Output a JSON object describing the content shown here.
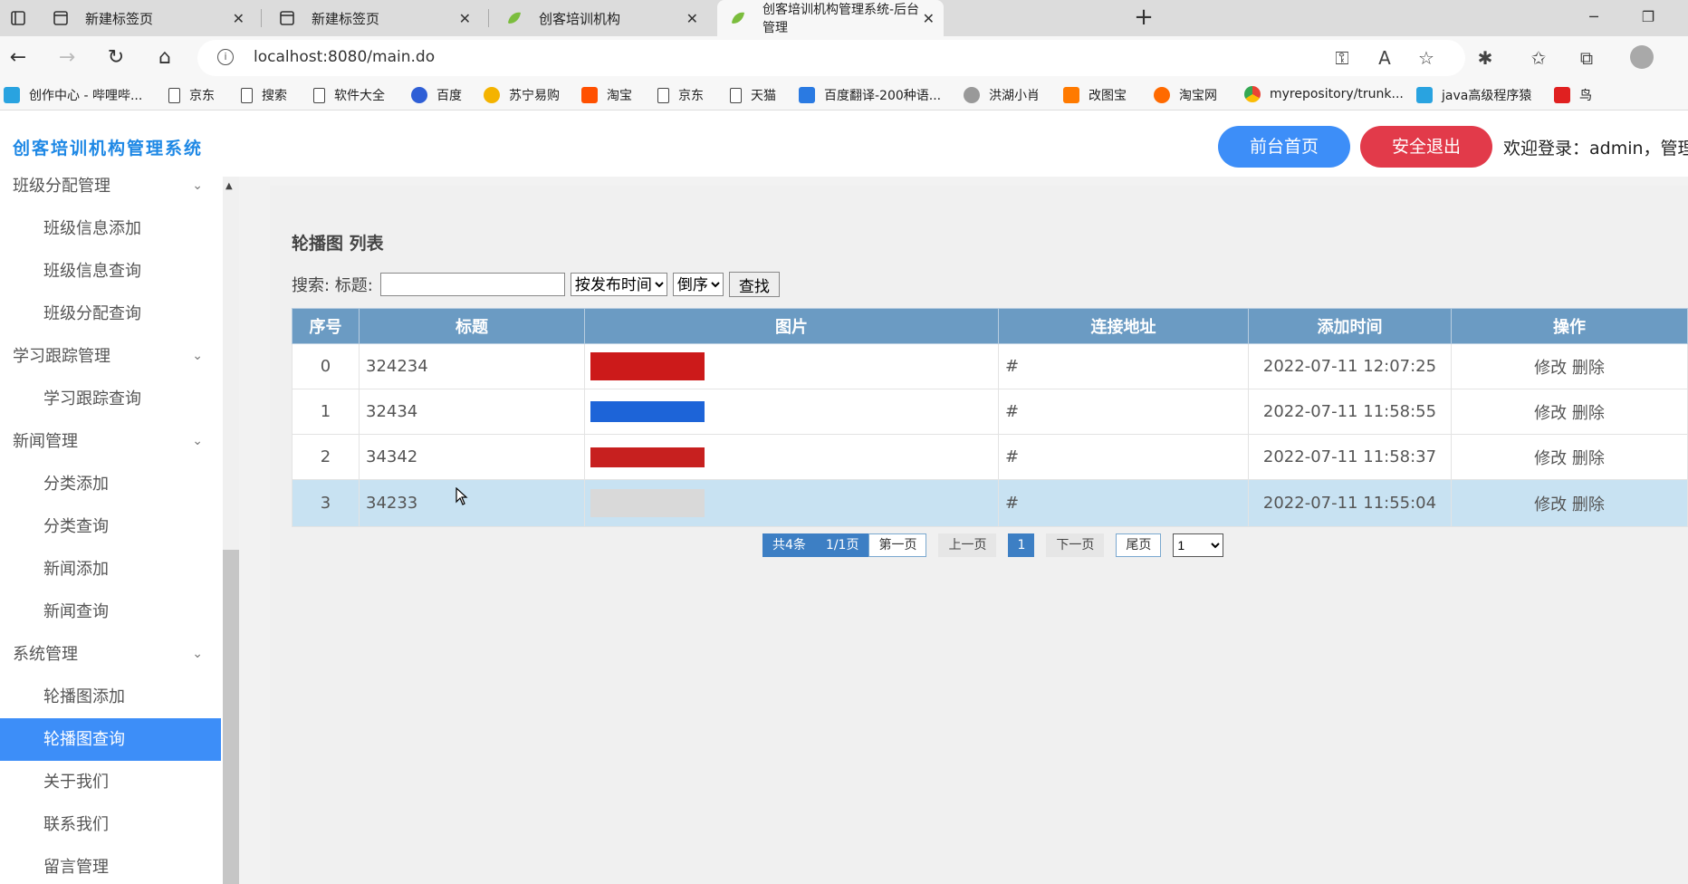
{
  "browser": {
    "tabs": [
      {
        "title": "新建标签页",
        "active": false
      },
      {
        "title": "新建标签页",
        "active": false
      },
      {
        "title": "创客培训机构",
        "active": false
      },
      {
        "title": "创客培训机构管理系统-后台管理",
        "active": true
      }
    ],
    "url": "localhost:8080/main.do",
    "bookmarks": [
      "创作中心 - 哔哩哔...",
      "京东",
      "搜索",
      "软件大全",
      "百度",
      "苏宁易购",
      "淘宝",
      "京东",
      "天猫",
      "百度翻译-200种语...",
      "洪湖小肖",
      "改图宝",
      "淘宝网",
      "myrepository/trunk...",
      "java高级程序猿",
      "鸟"
    ]
  },
  "header": {
    "title": "创客培训机构管理系统",
    "home_button": "前台首页",
    "logout_button": "安全退出",
    "welcome": "欢迎登录：admin，管理员"
  },
  "sidebar": {
    "items": [
      {
        "label": "班级分配管理",
        "type": "group"
      },
      {
        "label": "班级信息添加",
        "type": "child"
      },
      {
        "label": "班级信息查询",
        "type": "child"
      },
      {
        "label": "班级分配查询",
        "type": "child"
      },
      {
        "label": "学习跟踪管理",
        "type": "group"
      },
      {
        "label": "学习跟踪查询",
        "type": "child"
      },
      {
        "label": "新闻管理",
        "type": "group"
      },
      {
        "label": "分类添加",
        "type": "child"
      },
      {
        "label": "分类查询",
        "type": "child"
      },
      {
        "label": "新闻添加",
        "type": "child"
      },
      {
        "label": "新闻查询",
        "type": "child"
      },
      {
        "label": "系统管理",
        "type": "group"
      },
      {
        "label": "轮播图添加",
        "type": "child"
      },
      {
        "label": "轮播图查询",
        "type": "child",
        "active": true
      },
      {
        "label": "关于我们",
        "type": "child"
      },
      {
        "label": "联系我们",
        "type": "child"
      },
      {
        "label": "留言管理",
        "type": "child"
      }
    ]
  },
  "main": {
    "title": "轮播图 列表",
    "search": {
      "label": "搜索: 标题:",
      "value": "",
      "sort_field": "按发布时间",
      "sort_order": "倒序",
      "button": "查找"
    },
    "table": {
      "columns": [
        "序号",
        "标题",
        "图片",
        "连接地址",
        "添加时间",
        "操作"
      ],
      "rows": [
        {
          "index": "0",
          "title": "324234",
          "image_color": "#cc1a1a",
          "link": "#",
          "time": "2022-07-11 12:07:25",
          "edit": "修改",
          "delete": "删除"
        },
        {
          "index": "1",
          "title": "32434",
          "image_color": "#1d64d8",
          "link": "#",
          "time": "2022-07-11 11:58:55",
          "edit": "修改",
          "delete": "删除"
        },
        {
          "index": "2",
          "title": "34342",
          "image_color": "#c7201f",
          "link": "#",
          "time": "2022-07-11 11:58:37",
          "edit": "修改",
          "delete": "删除"
        },
        {
          "index": "3",
          "title": "34233",
          "image_color": "#d9d9d9",
          "link": "#",
          "time": "2022-07-11 11:55:04",
          "edit": "修改",
          "delete": "删除"
        }
      ],
      "highlighted_row": 3
    },
    "pager": {
      "total": "共4条",
      "pages": "1/1页",
      "first": "第一页",
      "prev": "上一页",
      "current": "1",
      "next": "下一页",
      "last": "尾页",
      "select_value": "1"
    }
  },
  "colors": {
    "accent": "#3d8ef8",
    "danger": "#e23a4a",
    "table_header": "#6b9bc3",
    "title": "#1e88e5"
  }
}
